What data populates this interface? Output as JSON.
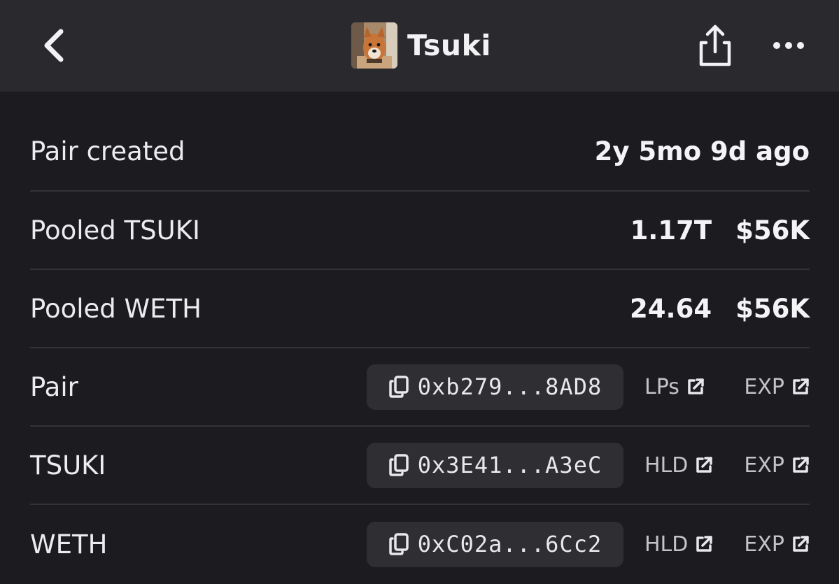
{
  "header": {
    "title": "Tsuki",
    "back_icon": "chevron-left-icon",
    "share_icon": "share-icon",
    "more_icon": "more-dots-icon"
  },
  "info": {
    "pair_created": {
      "label": "Pair created",
      "value": "2y 5mo 9d ago"
    },
    "pooled_tsuki": {
      "label": "Pooled TSUKI",
      "amount": "1.17T",
      "usd": "$56K"
    },
    "pooled_weth": {
      "label": "Pooled WETH",
      "amount": "24.64",
      "usd": "$56K"
    }
  },
  "addresses": [
    {
      "label": "Pair",
      "address": "0xb279...8AD8",
      "link1": "LPs",
      "link2": "EXP"
    },
    {
      "label": "TSUKI",
      "address": "0x3E41...A3eC",
      "link1": "HLD",
      "link2": "EXP"
    },
    {
      "label": "WETH",
      "address": "0xC02a...6Cc2",
      "link1": "HLD",
      "link2": "EXP"
    }
  ],
  "colors": {
    "background": "#1c1c20",
    "header": "#2a2a2e",
    "pill": "#2e2e33",
    "divider": "#323237"
  }
}
